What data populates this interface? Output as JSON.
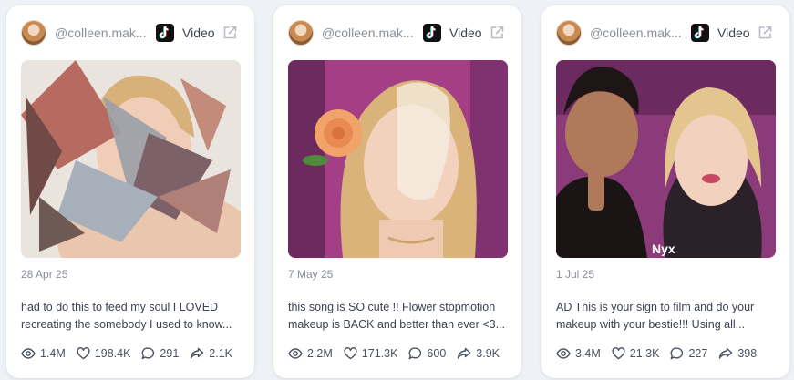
{
  "cards": [
    {
      "handle": "@colleen.mak...",
      "type_label": "Video",
      "date": "28 Apr 25",
      "caption_line1": "had to do this to feed my soul I LOVED",
      "caption_line2": "recreating the somebody I used to know...",
      "views": "1.4M",
      "likes": "198.4K",
      "comments": "291",
      "shares": "2.1K"
    },
    {
      "handle": "@colleen.mak...",
      "type_label": "Video",
      "date": "7 May 25",
      "caption_line1": "this song is SO cute !! Flower stopmotion",
      "caption_line2": "makeup is BACK and better than ever <3...",
      "views": "2.2M",
      "likes": "171.3K",
      "comments": "600",
      "shares": "3.9K"
    },
    {
      "handle": "@colleen.mak...",
      "type_label": "Video",
      "date": "1 Jul 25",
      "caption_line1": "AD This is your sign to film and do your",
      "caption_line2": "makeup with your bestie!!! Using all...",
      "views": "3.4M",
      "likes": "21.3K",
      "comments": "227",
      "shares": "398",
      "thumb_overlay": "Nyx"
    }
  ],
  "colors": {
    "page_bg": "#eef1f5",
    "card_bg": "#ffffff",
    "muted_text": "#8a8f98",
    "body_text": "#3c4250"
  },
  "icons": [
    "tiktok-icon",
    "external-link-icon",
    "eye-icon",
    "heart-icon",
    "comment-icon",
    "share-icon"
  ]
}
